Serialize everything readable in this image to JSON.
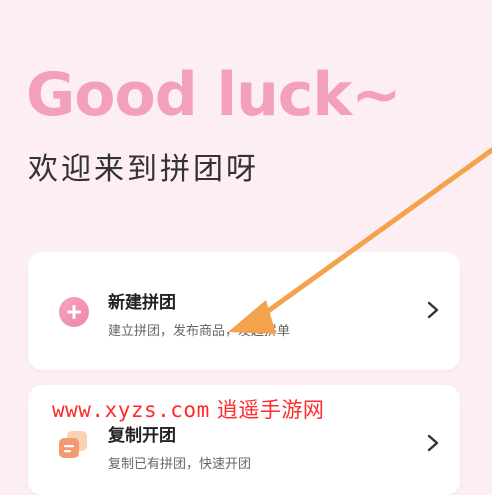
{
  "hero": {
    "title": "Good luck~",
    "subtitle": "欢迎来到拼团呀"
  },
  "cards": [
    {
      "title": "新建拼团",
      "desc": "建立拼团，发布商品，发起拼单",
      "icon": "plus-circle-icon"
    },
    {
      "title": "复制开团",
      "desc": "复制已有拼团，快速开团",
      "icon": "copy-doc-icon"
    }
  ],
  "watermark": {
    "url": "www.xyzs.com",
    "site": "逍遥手游网"
  },
  "colors": {
    "background": "#fdeef3",
    "title_pink": "#f2a0bb",
    "arrow_orange": "#f4a34d",
    "watermark_red": "#ff2b2b"
  }
}
